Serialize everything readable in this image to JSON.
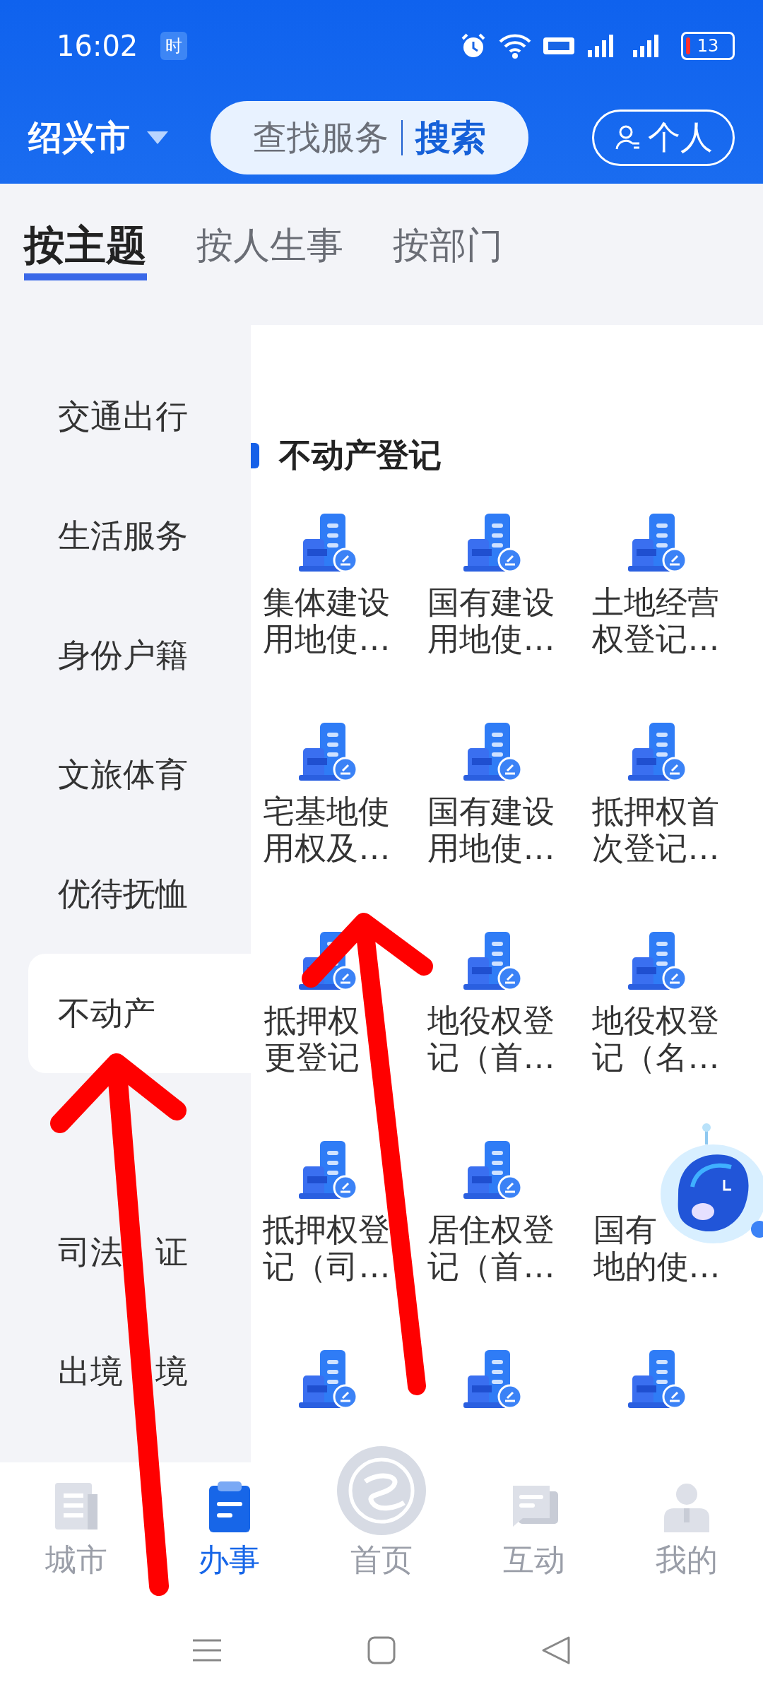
{
  "status_bar": {
    "time": "16:02",
    "badge": "时",
    "battery": "13"
  },
  "header": {
    "city": "绍兴市",
    "search": {
      "placeholder": "查找服务",
      "button": "搜索"
    },
    "profile_button": "个人"
  },
  "tabs": [
    {
      "label": "按主题",
      "selected": true
    },
    {
      "label": "按人生事",
      "selected": false
    },
    {
      "label": "按部门",
      "selected": false
    }
  ],
  "sidebar": {
    "items": [
      {
        "label": "交通出行",
        "selected": false
      },
      {
        "label": "生活服务",
        "selected": false
      },
      {
        "label": "身份户籍",
        "selected": false
      },
      {
        "label": "文旅体育",
        "selected": false
      },
      {
        "label": "优待抚恤",
        "selected": false
      },
      {
        "label": "不动产",
        "selected": true
      },
      {
        "selected": false
      },
      {
        "label_parts": [
          "司法",
          "证"
        ],
        "selected": false
      },
      {
        "label_parts": [
          "出境",
          "境"
        ],
        "selected": false
      }
    ]
  },
  "section": {
    "title": "不动产登记",
    "services": [
      {
        "kind": "full",
        "label": "集体建设用地使…"
      },
      {
        "kind": "full",
        "label": "国有建设用地使…"
      },
      {
        "kind": "full",
        "label": "土地经营权登记…"
      },
      {
        "kind": "full",
        "label": "宅基地使用权及…"
      },
      {
        "kind": "full",
        "label": "国有建设用地使…"
      },
      {
        "kind": "full",
        "label": "抵押权首次登记…"
      },
      {
        "kind": "full",
        "lines": [
          "抵押权",
          "更登记"
        ]
      },
      {
        "kind": "full",
        "label": "地役权登记（首…"
      },
      {
        "kind": "full",
        "label": "地役权登记（名…"
      },
      {
        "kind": "full",
        "label": "抵押权登记（司…"
      },
      {
        "kind": "full",
        "label": "居住权登记（首…"
      },
      {
        "kind": "covered",
        "lines": [
          "国有",
          "地的使…"
        ]
      },
      {
        "kind": "icon_only"
      },
      {
        "kind": "icon_only"
      },
      {
        "kind": "icon_only"
      }
    ]
  },
  "bottom_nav": [
    {
      "label": "城市",
      "selected": false,
      "kind": "city"
    },
    {
      "label": "办事",
      "selected": true,
      "kind": "tasks"
    },
    {
      "label": "首页",
      "selected": false,
      "kind": "home"
    },
    {
      "label": "互动",
      "selected": false,
      "kind": "chat"
    },
    {
      "label": "我的",
      "selected": false,
      "kind": "me"
    }
  ]
}
